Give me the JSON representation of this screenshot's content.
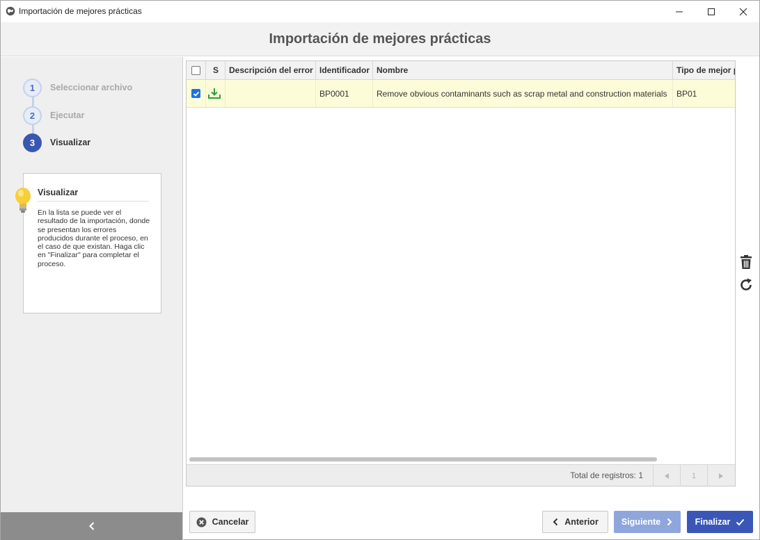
{
  "window": {
    "title": "Importación de mejores prácticas",
    "icon": "globe-icon"
  },
  "header": {
    "title": "Importación de mejores prácticas"
  },
  "steps": [
    {
      "number": "1",
      "label": "Seleccionar archivo",
      "state": "done"
    },
    {
      "number": "2",
      "label": "Ejecutar",
      "state": "done"
    },
    {
      "number": "3",
      "label": "Visualizar",
      "state": "active"
    }
  ],
  "help": {
    "title": "Visualizar",
    "text": "En la lista se puede ver el resultado de la importación, donde se presentan los errores producidos durante el proceso, en el caso de que existan. Haga clic en \"Finalizar\" para completar el proceso.",
    "icon": "lightbulb-icon"
  },
  "grid": {
    "columns": [
      "S",
      "Descripción del error",
      "Identificador",
      "Nombre",
      "Tipo de mejor p"
    ],
    "rows": [
      {
        "checked": true,
        "status_icon": "download-icon",
        "error": "",
        "id": "BP0001",
        "name": "Remove obvious contaminants such as scrap metal and construction materials",
        "type": "BP01"
      }
    ],
    "footer": {
      "total_label": "Total de registros: 1",
      "page": "1"
    }
  },
  "tools": [
    "trash-icon",
    "refresh-icon"
  ],
  "buttons": {
    "cancel": "Cancelar",
    "previous": "Anterior",
    "next": "Siguiente",
    "finish": "Finalizar"
  },
  "colors": {
    "primary": "#3a57b8",
    "disabled_primary": "#8fa6dd",
    "row_highlight": "#fcfcd8",
    "status_green": "#2e9e3e"
  }
}
